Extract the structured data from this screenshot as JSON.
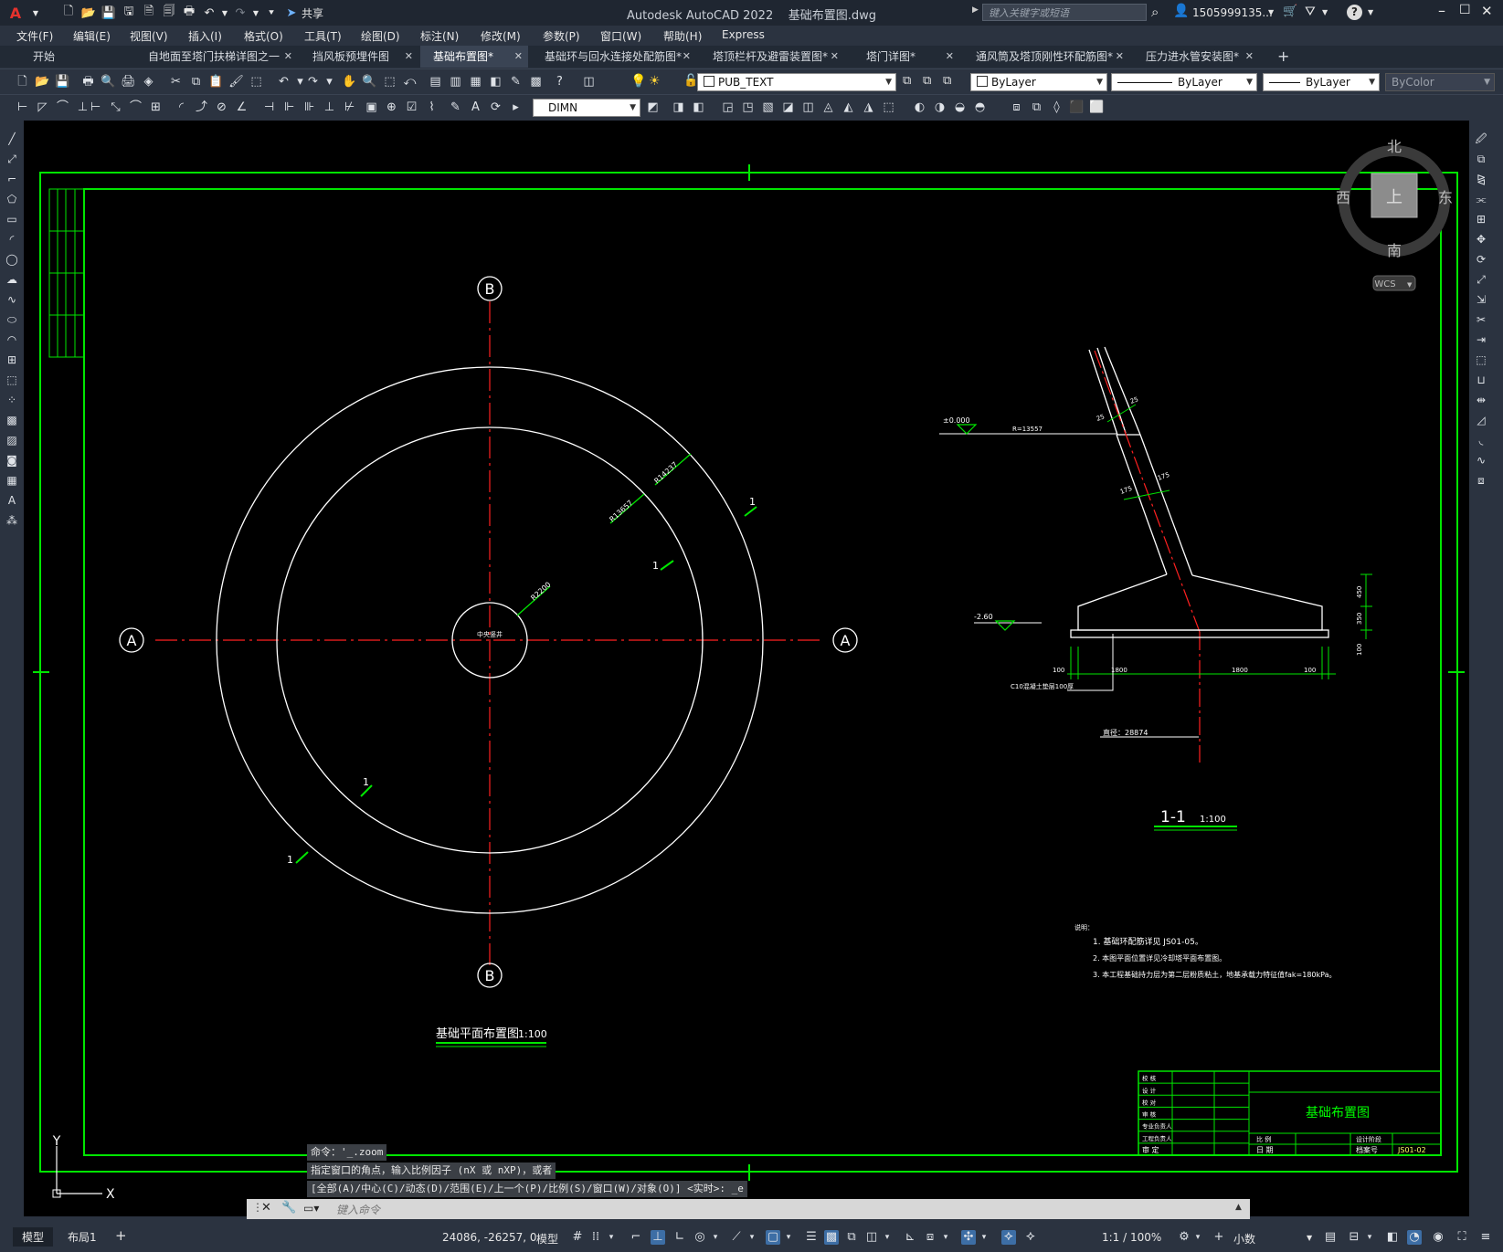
{
  "app": {
    "title": "Autodesk AutoCAD 2022",
    "file": "基础布置图.dwg",
    "share": "共享",
    "search_placeholder": "键入关键字或短语",
    "user": "1505999135...",
    "help": "?"
  },
  "menu": [
    "文件(F)",
    "编辑(E)",
    "视图(V)",
    "插入(I)",
    "格式(O)",
    "工具(T)",
    "绘图(D)",
    "标注(N)",
    "修改(M)",
    "参数(P)",
    "窗口(W)",
    "帮助(H)",
    "Express"
  ],
  "tabs": [
    {
      "label": "开始"
    },
    {
      "label": "自地面至塔门扶梯详图之一"
    },
    {
      "label": "挡风板预埋件图"
    },
    {
      "label": "基础布置图*"
    },
    {
      "label": "基础环与回水连接处配筋图*"
    },
    {
      "label": "塔顶栏杆及避雷装置图*"
    },
    {
      "label": "塔门详图*"
    },
    {
      "label": "通风筒及塔顶刚性环配筋图*"
    },
    {
      "label": "压力进水管安装图*"
    }
  ],
  "toolbar": {
    "layer": "PUB_TEXT",
    "color": "ByLayer",
    "linetype": "ByLayer",
    "lineweight": "ByLayer",
    "plotstyle": "ByColor",
    "dimstyle": "DIMN"
  },
  "viewcube": {
    "north": "北",
    "south": "南",
    "east": "东",
    "west": "西",
    "face": "上",
    "wcs": "WCS"
  },
  "drawing": {
    "axis_a": "A",
    "axis_b": "B",
    "center_label": "中央竖井",
    "r_inner": "R2200",
    "r_mid": "R13657",
    "r_outer": "R14237",
    "section_mark": "1",
    "plan_title": "基础平面布置图",
    "plan_scale": "1:100",
    "section_title": "1-1",
    "section_scale": "1:100",
    "elev_top": "±0.000",
    "elev_bottom": "-2.60",
    "radius_label": "R=13557",
    "dim_25a": "25",
    "dim_25b": "25",
    "dim_175a": "175",
    "dim_175b": "175",
    "dim_450": "450",
    "dim_350": "350",
    "dim_100v": "100",
    "dim_100l": "100",
    "dim_1800a": "1800",
    "dim_1800b": "1800",
    "dim_100r": "100",
    "c10_note": "C10混凝土垫层100厚",
    "diameter_note": "直径：28874",
    "notes_title": "说明：",
    "notes": [
      "1.  基础环配筋详见 JS01-05。",
      "2.  本图平面位置详见冷却塔平面布置图。",
      "3. 本工程基础持力层为第二层粉质粘土，地基承载力特征值fak=180kPa。"
    ],
    "title_block": {
      "drawing_name": "基础布置图",
      "left_rows": [
        "校 核",
        "设 计",
        "校 对",
        "审 核",
        "专业负责人",
        "工程负责人",
        "审 定"
      ],
      "scale_label": "比 例",
      "date_label": "日 期",
      "phase_label": "设计阶段",
      "number_label": "档案号",
      "number": "JS01-02"
    }
  },
  "ucs": {
    "x": "X",
    "y": "Y"
  },
  "command": {
    "line1": "命令：'_.zoom",
    "line2": "指定窗口的角点，输入比例因子 (nX 或 nXP)，或者",
    "line3": "[全部(A)/中心(C)/动态(D)/范围(E)/上一个(P)/比例(S)/窗口(W)/对象(O)] <实时>: _e",
    "placeholder": "键入命令"
  },
  "status": {
    "model_tab": "模型",
    "layout_tab": "布局1",
    "add_tab": "+",
    "coords": "24086, -26257, 0",
    "mode": "模型",
    "scale": "1:1 / 100%",
    "units": "小数"
  },
  "colors": {
    "accent": "#00ff00",
    "axis": "#ff0000",
    "bg": "#000000"
  }
}
